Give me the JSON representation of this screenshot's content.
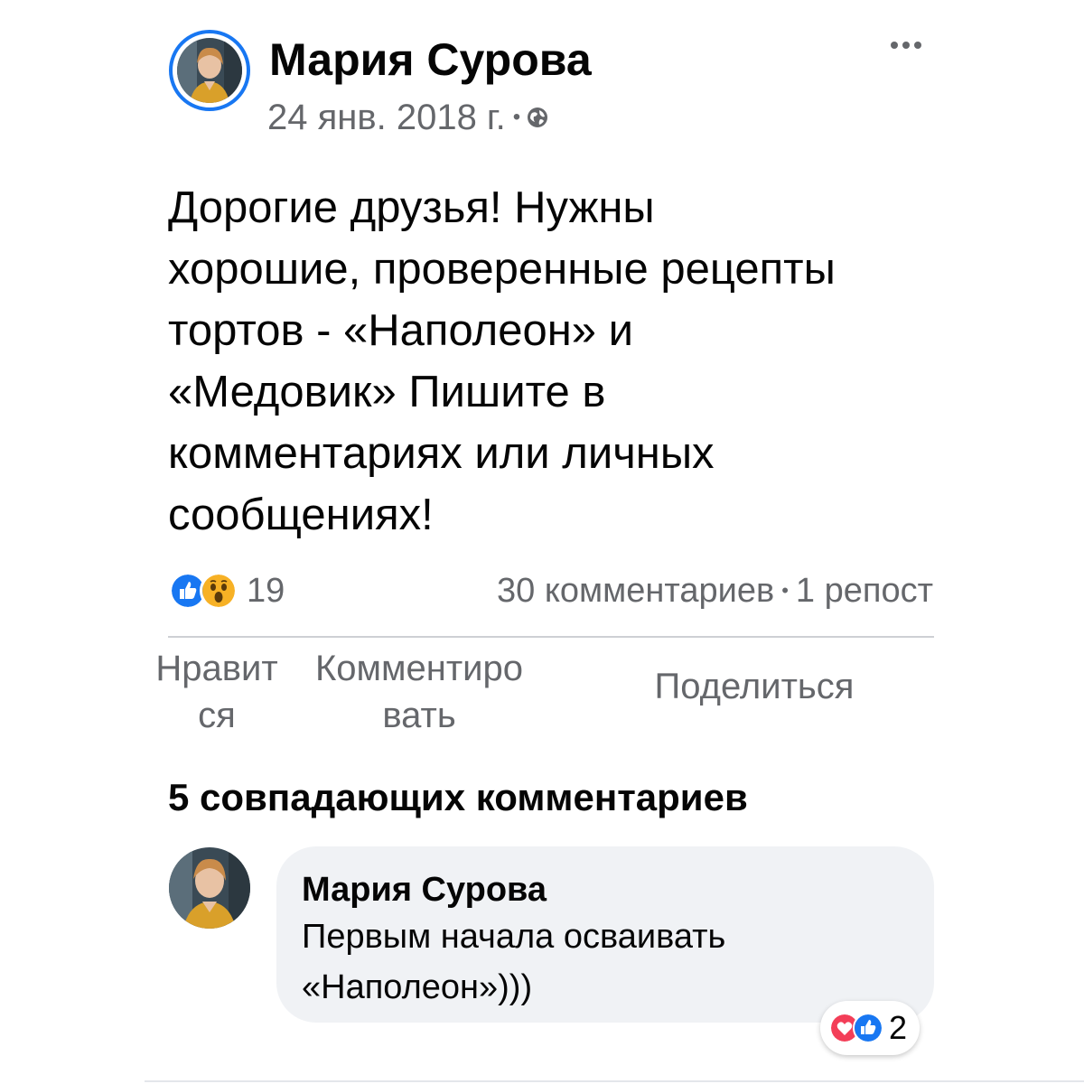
{
  "post": {
    "author": "Мария Сурова",
    "date": "24 янв. 2018 г.",
    "meta_separator": "•",
    "privacy_icon": "globe-icon",
    "more_icon": "more-options-icon",
    "text": "Дорогие друзья! Нужны\nхорошие, проверенные рецепты\nтортов - «Наполеон» и\n«Медовик» Пишите в\nкомментариях или личных\nсообщениях!"
  },
  "stats": {
    "reaction_icons": [
      "like-icon",
      "wow-icon"
    ],
    "reaction_count": "19",
    "comments": "30 комментариев",
    "separator": "•",
    "shares": "1 репост"
  },
  "actions": {
    "like": "Нравит\nся",
    "comment": "Комментиро\nвать",
    "share": "Поделиться"
  },
  "comments_section": {
    "heading": "5 совпадающих комментариев",
    "items": [
      {
        "author": "Мария Сурова",
        "text": "Первым начала осваивать\n«Наполеон»)))",
        "reaction_icons": [
          "love-icon",
          "like-icon"
        ],
        "reaction_count": "2"
      }
    ]
  },
  "colors": {
    "accent": "#1877f2",
    "secondary_text": "#65676b",
    "bubble": "#f0f2f5",
    "love": "#f33e58",
    "wow": "#f7b125"
  }
}
